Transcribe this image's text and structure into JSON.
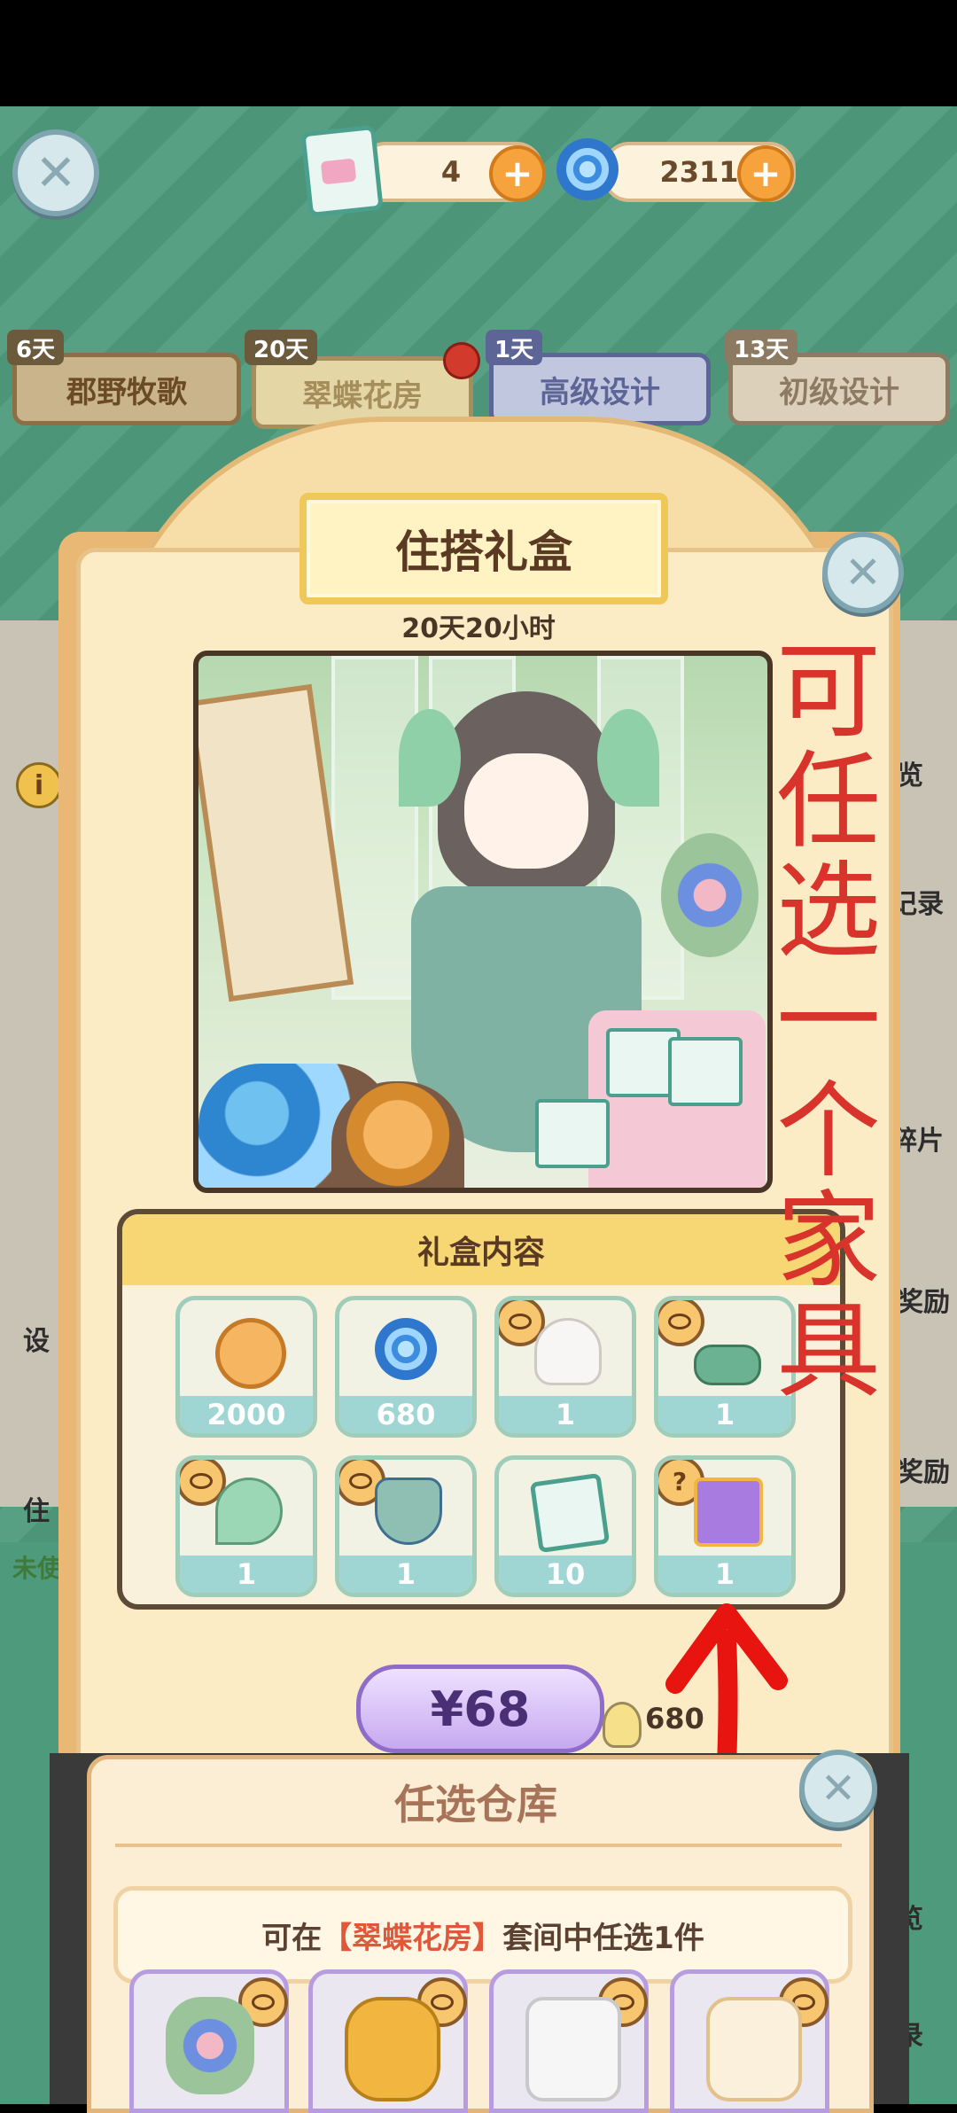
{
  "top_bar": {
    "ticket_count": "4",
    "swirl_count": "2311",
    "close_icon": "close-icon",
    "plus_icon": "plus-icon"
  },
  "tabs": [
    {
      "days": "6天",
      "label": "郡野牧歌"
    },
    {
      "days": "20天",
      "label": "翠蝶花房"
    },
    {
      "days": "1天",
      "label": "高级设计"
    },
    {
      "days": "13天",
      "label": "初级设计"
    }
  ],
  "gift_box": {
    "title": "住搭礼盒",
    "timer": "20天20小时",
    "contents_title": "礼盒内容",
    "items": [
      {
        "icon": "coin-icon",
        "qty": "2000"
      },
      {
        "icon": "swirl-icon",
        "qty": "680"
      },
      {
        "icon": "hair-icon",
        "qty": "1"
      },
      {
        "icon": "shoes-icon",
        "qty": "1"
      },
      {
        "icon": "wings-icon",
        "qty": "1"
      },
      {
        "icon": "dress-icon",
        "qty": "1"
      },
      {
        "icon": "ticket-icon",
        "qty": "10"
      },
      {
        "icon": "giftbox-icon",
        "qty": "1"
      }
    ],
    "price": "¥68",
    "bulb_value": "680"
  },
  "side_partial_labels": {
    "right": [
      "览",
      "记录",
      "碎片",
      "奖励",
      "奖励",
      "览",
      "录"
    ],
    "left": [
      "设",
      "住",
      "未使"
    ]
  },
  "annotation": {
    "chars": [
      "可",
      "任",
      "选",
      "一",
      "个",
      "家",
      "具"
    ],
    "color": "#d8342c"
  },
  "optional_storage": {
    "title": "任选仓库",
    "desc_prefix": "可在",
    "desc_highlight": "【翠蝶花房】",
    "desc_suffix": "套间中任选1件",
    "items": [
      "bouquet-icon",
      "watering-can-icon",
      "canopy-bed-icon",
      "sofa-icon"
    ]
  },
  "colors": {
    "background_green": "#4e9a7c",
    "accent_orange": "#f6a33d",
    "price_purple": "#8f6cc9",
    "annotation_red": "#d8342c"
  }
}
